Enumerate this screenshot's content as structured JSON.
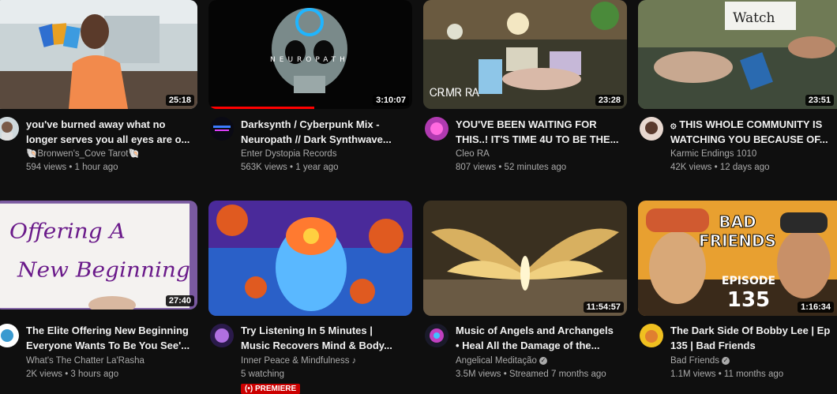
{
  "videos": [
    {
      "title1": "you've burned away what no",
      "title2": "longer serves you all eyes are o...",
      "channel": "🐚Bronwen's_Cove Tarot🐚",
      "stats": "594 views • 1 hour ago",
      "duration": "25:18"
    },
    {
      "title1": "Darksynth / Cyberpunk Mix -",
      "title2": "Neuropath // Dark Synthwave...",
      "channel": "Enter Dystopia Records",
      "stats": "563K views • 1 year ago",
      "duration": "3:10:07",
      "thumb_text": "NEUROPATH",
      "watched_fraction": 0.52
    },
    {
      "title1": "YOU'VE BEEN WAITING FOR",
      "title2": "THIS..! IT'S TIME 4U TO BE THE...",
      "channel": "Cleo RA",
      "stats": "807 views • 52 minutes ago",
      "duration": "23:28",
      "thumb_text": "ᏟᎡᎷᏒ ᏒᎪ"
    },
    {
      "title1": "۞ THIS WHOLE COMMUNITY IS",
      "title2": "WATCHING YOU BECAUSE OF...",
      "channel": "Karmic Endings 1010",
      "stats": "42K views • 12 days ago",
      "duration": "23:51",
      "thumb_text": "Watch"
    },
    {
      "title1": "The Elite Offering New Beginning",
      "title2": "Everyone Wants To Be You See'...",
      "channel": "What's The Chatter La'Rasha",
      "stats": "2K views • 3 hours ago",
      "duration": "27:40",
      "thumb_text1": "Offering A",
      "thumb_text2": "New Beginning"
    },
    {
      "title1": "Try Listening In 5 Minutes |",
      "title2": "Music Recovers Mind & Body...",
      "channel": "Inner Peace & Mindfulness ♪",
      "stats": "5 watching",
      "badge": "(•) PREMIERE"
    },
    {
      "title1": "Music of Angels and Archangels",
      "title2": "• Heal All the Damage of the...",
      "channel": "Angelical Meditação",
      "stats": "3.5M views • Streamed 7 months ago",
      "duration": "11:54:57",
      "verified": "✓"
    },
    {
      "title1": "The Dark Side Of Bobby Lee | Ep",
      "title2": "135 | Bad Friends",
      "channel": "Bad Friends",
      "stats": "1.1M views • 11 months ago",
      "duration": "1:16:34",
      "verified": "✓",
      "thumb_text1": "BAD",
      "thumb_text2": "FRIENDS",
      "thumb_text3": "EPISODE",
      "thumb_text4": "135"
    }
  ]
}
